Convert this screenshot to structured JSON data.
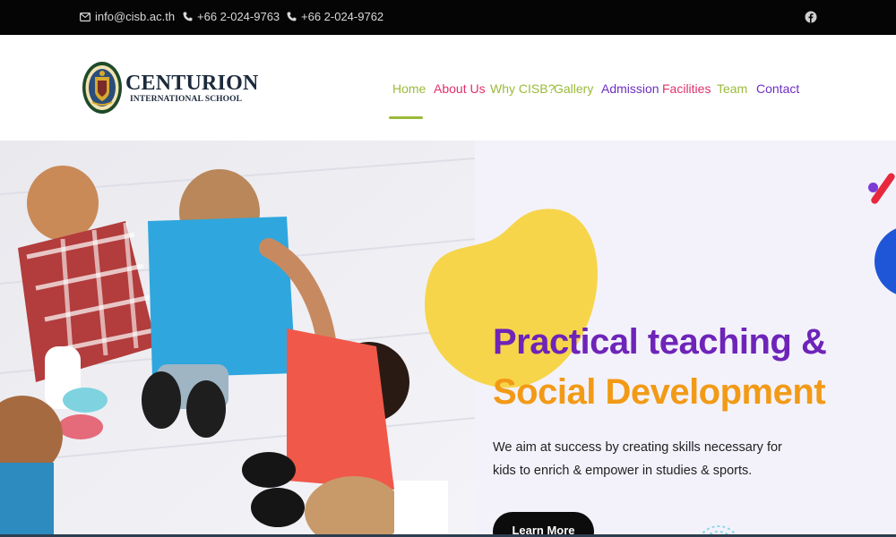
{
  "topbar": {
    "email": "info@cisb.ac.th",
    "phone_1": "+66 2-024-9763",
    "phone_2": "+66 2-024-9762",
    "icons": {
      "email": "envelope-icon",
      "phone": "phone-icon",
      "social": "facebook-icon"
    }
  },
  "logo": {
    "title": "CENTURION",
    "subtitle": "INTERNATIONAL SCHOOL"
  },
  "nav": {
    "items": [
      {
        "label": "Home",
        "color": "#9bba3b",
        "active": true
      },
      {
        "label": "About Us",
        "color": "#e0306a"
      },
      {
        "label": "Why CISB?",
        "color": "#9bba3b"
      },
      {
        "label": "Gallery",
        "color": "#9bba3b"
      },
      {
        "label": "Admission",
        "color": "#6e2fc4"
      },
      {
        "label": "Facilities",
        "color": "#e0306a"
      },
      {
        "label": "Team",
        "color": "#9bba3b"
      },
      {
        "label": "Contact",
        "color": "#6e2fc4"
      }
    ]
  },
  "hero": {
    "title_line_1": "Practical teaching &",
    "title_line_2": "Social Development",
    "text": "We aim at success by creating skills necessary for kids to enrich & empower in studies & sports.",
    "button_label": "Learn More",
    "colors": {
      "title_1": "#6e24b8",
      "title_2": "#f29a16",
      "blob": "#f7d54a",
      "button": "#0c0c0c"
    }
  }
}
